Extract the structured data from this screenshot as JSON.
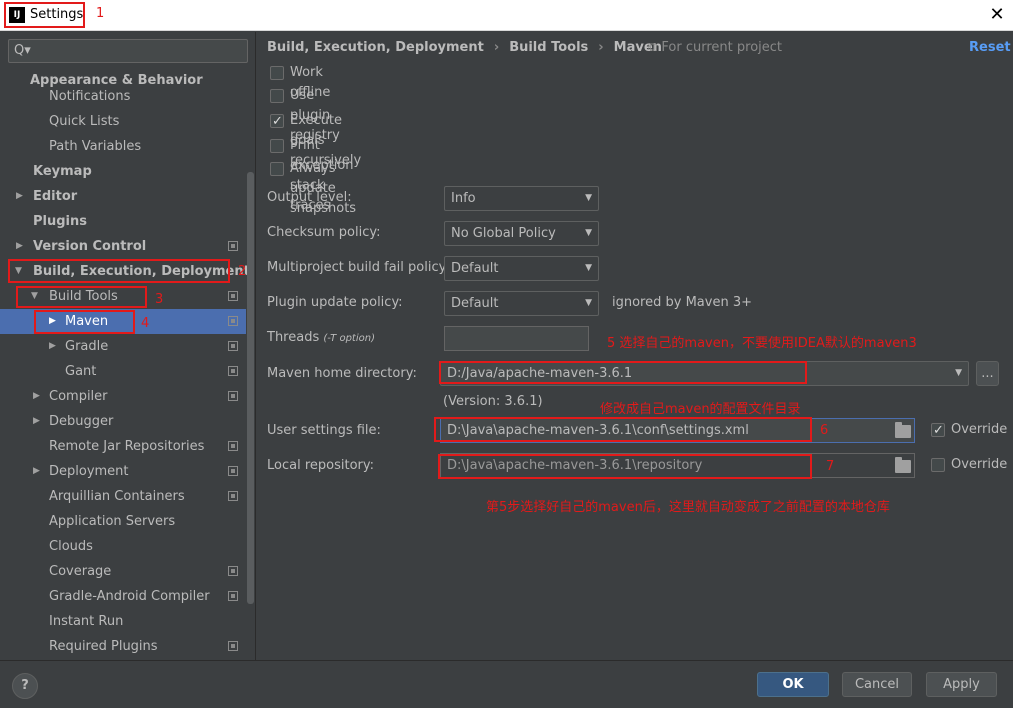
{
  "window": {
    "title": "Settings",
    "app_icon": "IJ",
    "close": "✕"
  },
  "search": {
    "placeholder": "",
    "icon": "Q▾"
  },
  "tree": [
    {
      "label": "Appearance & Behavior"
    },
    {
      "label": "Notifications"
    },
    {
      "label": "Quick Lists"
    },
    {
      "label": "Path Variables"
    },
    {
      "label": "Keymap"
    },
    {
      "label": "Editor"
    },
    {
      "label": "Plugins"
    },
    {
      "label": "Version Control"
    },
    {
      "label": "Build, Execution, Deployment"
    },
    {
      "label": "Build Tools"
    },
    {
      "label": "Maven"
    },
    {
      "label": "Gradle"
    },
    {
      "label": "Gant"
    },
    {
      "label": "Compiler"
    },
    {
      "label": "Debugger"
    },
    {
      "label": "Remote Jar Repositories"
    },
    {
      "label": "Deployment"
    },
    {
      "label": "Arquillian Containers"
    },
    {
      "label": "Application Servers"
    },
    {
      "label": "Clouds"
    },
    {
      "label": "Coverage"
    },
    {
      "label": "Gradle-Android Compiler"
    },
    {
      "label": "Instant Run"
    },
    {
      "label": "Required Plugins"
    }
  ],
  "breadcrumb": {
    "items": [
      "Build, Execution, Deployment",
      "Build Tools",
      "Maven"
    ],
    "separator": "›",
    "for_project": "For current project",
    "reset": "Reset"
  },
  "options": [
    {
      "label": "Work offline",
      "checked": false
    },
    {
      "label": "Use plugin registry",
      "checked": false
    },
    {
      "label": "Execute goals recursively",
      "checked": true
    },
    {
      "label": "Print exception stack traces",
      "checked": false
    },
    {
      "label": "Always update snapshots",
      "checked": false
    }
  ],
  "form": {
    "output_level": {
      "label": "Output level:",
      "value": "Info"
    },
    "checksum_policy": {
      "label": "Checksum policy:",
      "value": "No Global Policy"
    },
    "multiproject_fail": {
      "label": "Multiproject build fail policy:",
      "value": "Default"
    },
    "plugin_update": {
      "label": "Plugin update policy:",
      "value": "Default",
      "note": "ignored by Maven 3+"
    },
    "threads": {
      "label": "Threads",
      "hint": "(-T option)",
      "value": ""
    },
    "maven_home": {
      "label": "Maven home directory:",
      "value": "D:/Java/apache-maven-3.6.1",
      "browse": "..."
    },
    "version": "(Version: 3.6.1)",
    "user_settings": {
      "label": "User settings file:",
      "value": "D:\\Java\\apache-maven-3.6.1\\conf\\settings.xml",
      "override_label": "Override",
      "override": true
    },
    "local_repo": {
      "label": "Local repository:",
      "value": "D:\\Java\\apache-maven-3.6.1\\repository",
      "override_label": "Override",
      "override": false
    }
  },
  "annotations": {
    "n1": "1",
    "n2": "2",
    "n3": "3",
    "n4": "4",
    "n6": "6",
    "n7": "7",
    "note5": "5 选择自己的maven，不要使用IDEA默认的maven3",
    "note_settings": "修改成自己maven的配置文件目录",
    "note_repo": "第5步选择好自己的maven后，这里就自动变成了之前配置的本地仓库"
  },
  "buttons": {
    "help": "?",
    "ok": "OK",
    "cancel": "Cancel",
    "apply": "Apply"
  },
  "colors": {
    "background": "#3c3f41",
    "selection": "#4b6eaf",
    "annotation": "#e21a1a",
    "link": "#589df6"
  }
}
